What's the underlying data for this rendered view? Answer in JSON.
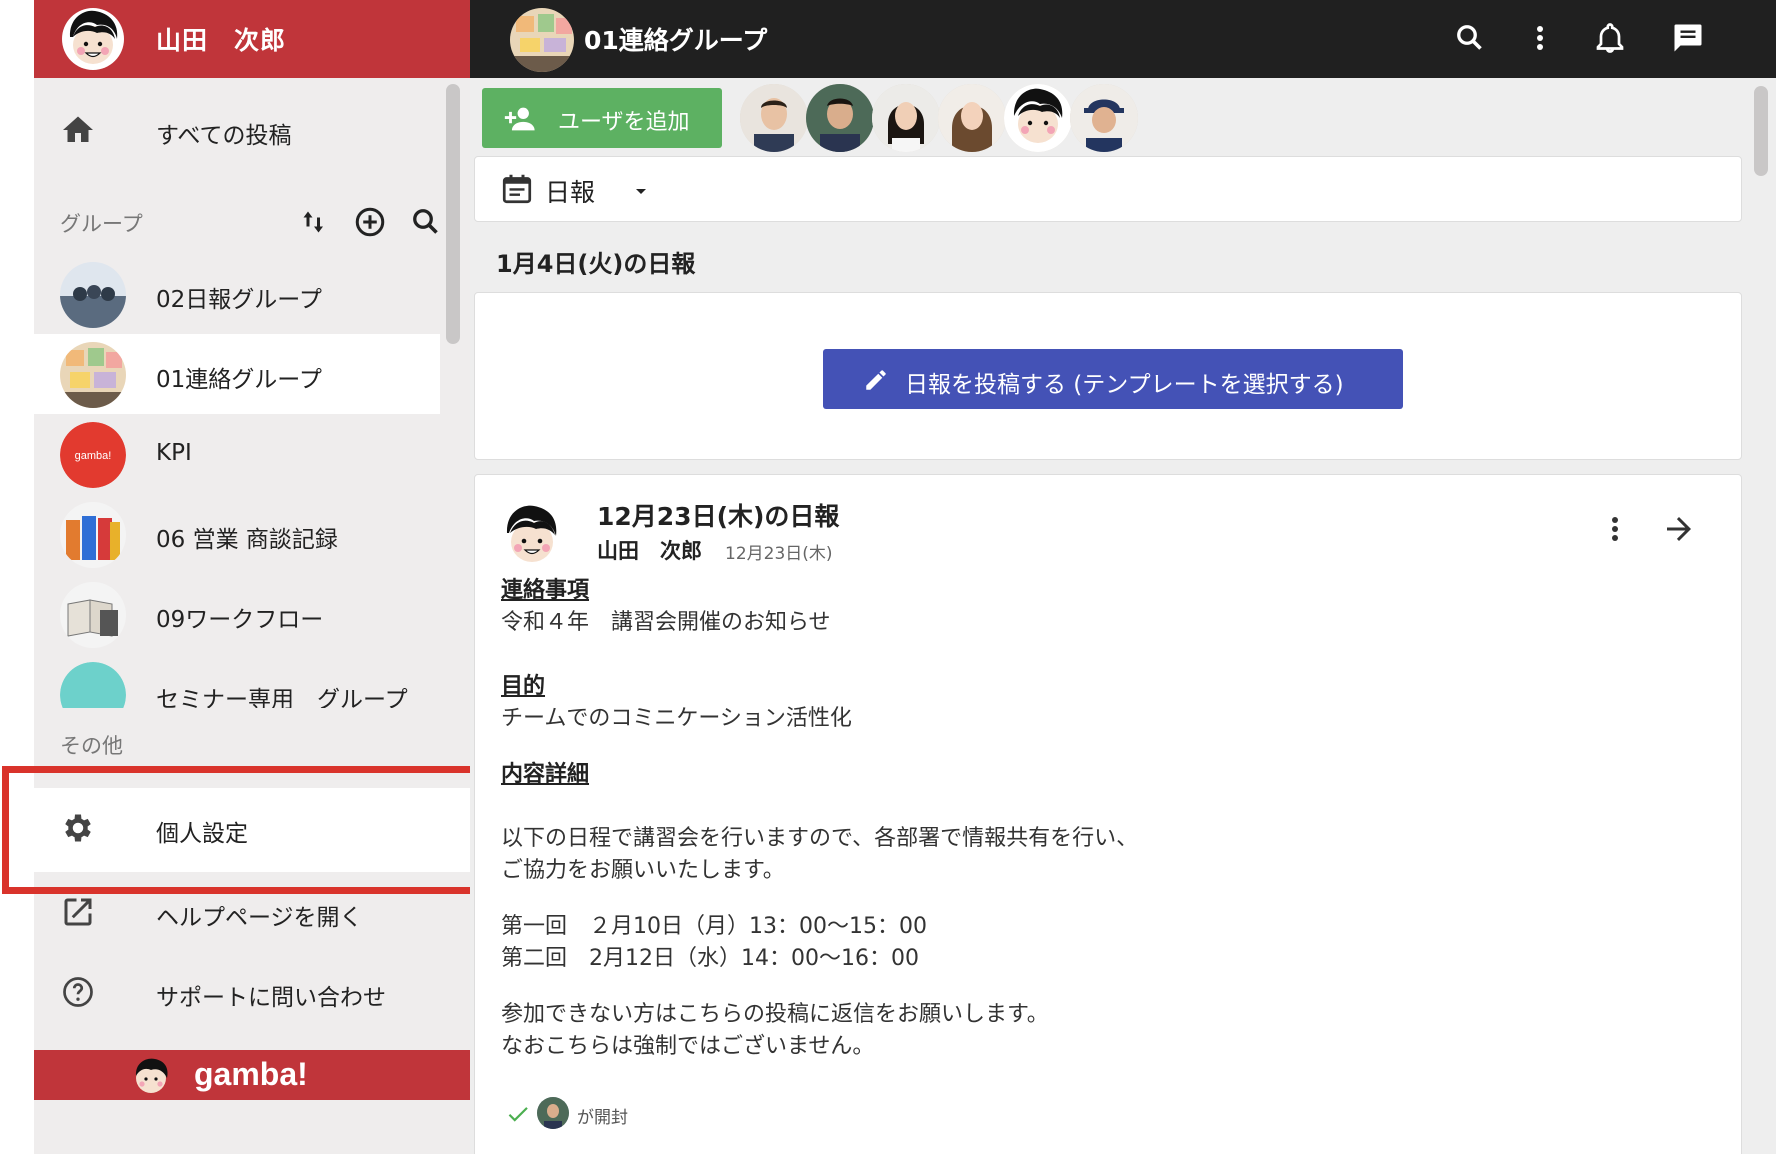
{
  "user": {
    "name": "山田　次郎"
  },
  "nav": {
    "all_posts": "すべての投稿"
  },
  "groups": {
    "header": "グループ",
    "items": [
      {
        "label": "02日報グループ"
      },
      {
        "label": "01連絡グループ"
      },
      {
        "label": "KPI"
      },
      {
        "label": "06 営業 商談記録"
      },
      {
        "label": "09ワークフロー"
      },
      {
        "label": "セミナー専用　グループ"
      }
    ]
  },
  "other": {
    "header": "その他",
    "personal_settings": "個人設定",
    "help_page": "ヘルプページを開く",
    "contact_support": "サポートに問い合わせ"
  },
  "footer": {
    "brand": "gamba!"
  },
  "topbar": {
    "group_title": "01連絡グループ"
  },
  "toolbar": {
    "add_user": "ユーザを追加"
  },
  "report_type": {
    "selected": "日報"
  },
  "date_heading": "1月4日(火)の日報",
  "compose": {
    "button": "日報を投稿する (テンプレートを選択する)"
  },
  "post": {
    "title": "12月23日(木)の日報",
    "author": "山田　次郎",
    "date": "12月23日(木)",
    "sections": {
      "contact_heading": "連絡事項",
      "contact_text": "令和４年　講習会開催のお知らせ",
      "purpose_heading": "目的",
      "purpose_text": "チームでのコミニケーション活性化",
      "details_heading": "内容詳細",
      "details_line1": "以下の日程で講習会を行いますので、各部署で情報共有を行い、",
      "details_line2": "ご協力をお願いいたします。",
      "schedule1": "第一回　２月10日（月）13：00〜15：00",
      "schedule2": "第二回　2月12日（水）14：00〜16：00",
      "closing1": "参加できない方はこちらの投稿に返信をお願いします。",
      "closing2": "なおこちらは強制ではございません。"
    },
    "read_status": "が開封"
  },
  "colors": {
    "brand_red": "#c0353a",
    "topbar": "#202020",
    "add_user_green": "#5db162",
    "compose_blue": "#4452b6",
    "highlight_red": "#d9332b"
  }
}
